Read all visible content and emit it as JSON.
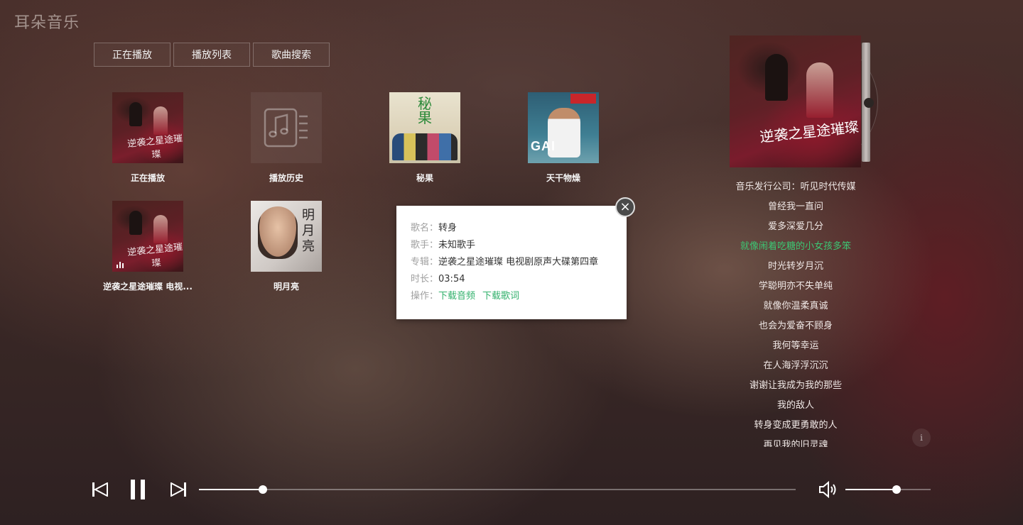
{
  "app": {
    "title": "耳朵音乐"
  },
  "tabs": [
    {
      "label": "正在播放"
    },
    {
      "label": "播放列表"
    },
    {
      "label": "歌曲搜索"
    }
  ],
  "grid": [
    {
      "label": "正在播放",
      "cover_art": "逆袭之星途璀璨"
    },
    {
      "label": "播放历史",
      "icon": "music-list-icon"
    },
    {
      "label": "秘果",
      "cover_art": "秘果"
    },
    {
      "label": "天干物燥",
      "cover_art": "GAI"
    },
    {
      "label": "逆袭之星途璀璨 电视...",
      "cover_art": "逆袭之星途璀璨",
      "playing": true
    },
    {
      "label": "明月亮",
      "cover_art": "明月亮"
    }
  ],
  "popup": {
    "rows": [
      {
        "key": "歌名：",
        "value": "转身"
      },
      {
        "key": "歌手：",
        "value": "未知歌手"
      },
      {
        "key": "专辑：",
        "value": "逆袭之星途璀璨 电视剧原声大碟第四章"
      },
      {
        "key": "时长：",
        "value": "03:54"
      }
    ],
    "actions_key": "操作：",
    "download_audio": "下载音频",
    "download_lyrics": "下载歌词",
    "close_glyph": "×"
  },
  "side_cover_art": "逆袭之星途璀璨",
  "lyrics": {
    "active_index": 3,
    "lines": [
      "音乐发行公司：听见时代传媒",
      "曾经我一直问",
      "爱多深爱几分",
      "就像闹着吃糖的小女孩多笨",
      "时光转岁月沉",
      "学聪明亦不失单纯",
      "就像你温柔真诚",
      "也会为爱奋不顾身",
      "我何等幸运",
      "在人海浮浮沉沉",
      "谢谢让我成为我的那些",
      "我的敌人",
      "转身变成更勇敢的人",
      "再见我的旧灵魂"
    ]
  },
  "info_glyph": "i",
  "player": {
    "progress": 0.107,
    "volume": 0.6
  },
  "colors": {
    "accent_green": "#32b16c",
    "active_lyric": "#3cc774"
  }
}
